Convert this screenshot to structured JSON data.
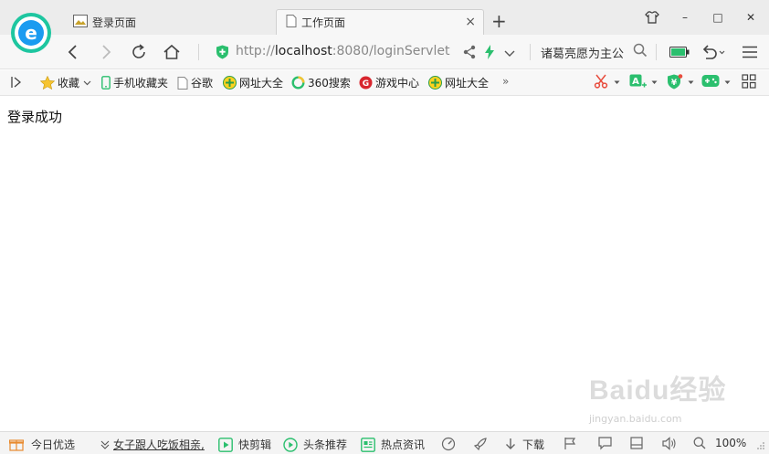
{
  "tabs": [
    {
      "title": "登录页面",
      "active": false
    },
    {
      "title": "工作页面",
      "active": true
    }
  ],
  "new_tab_glyph": "+",
  "tab_close_glyph": "×",
  "window_controls": {
    "minimize": "–",
    "maximize": "□",
    "close": "✕"
  },
  "address": {
    "scheme": "http://",
    "host": "localhost",
    "rest": ":8080/loginServlet"
  },
  "search": {
    "text": "诸葛亮愿为主公"
  },
  "bookmarks": [
    {
      "label": "收藏",
      "icon": "star-icon"
    },
    {
      "label": "手机收藏夹",
      "icon": "phone-icon"
    },
    {
      "label": "谷歌",
      "icon": "page-icon"
    },
    {
      "label": "网址大全",
      "icon": "website-directory-icon"
    },
    {
      "label": "360搜索",
      "icon": "360-search-icon"
    },
    {
      "label": "游戏中心",
      "icon": "game-center-icon"
    },
    {
      "label": "网址大全",
      "icon": "website-directory-icon"
    }
  ],
  "bookmarks_more": "»",
  "page": {
    "message": "登录成功"
  },
  "watermark": {
    "main": "Baidu经验",
    "sub": "jingyan.baidu.com"
  },
  "status": {
    "today": "今日优选",
    "news": "女子跟人吃饭相亲,",
    "clip": "快剪辑",
    "headline": "头条推荐",
    "hotnews": "热点资讯",
    "download": "下载",
    "zoom": "100%"
  },
  "colors": {
    "accent_green": "#2bbf6e",
    "logo_blue": "#1a9bf0",
    "scissors_red": "#e84c3d"
  }
}
